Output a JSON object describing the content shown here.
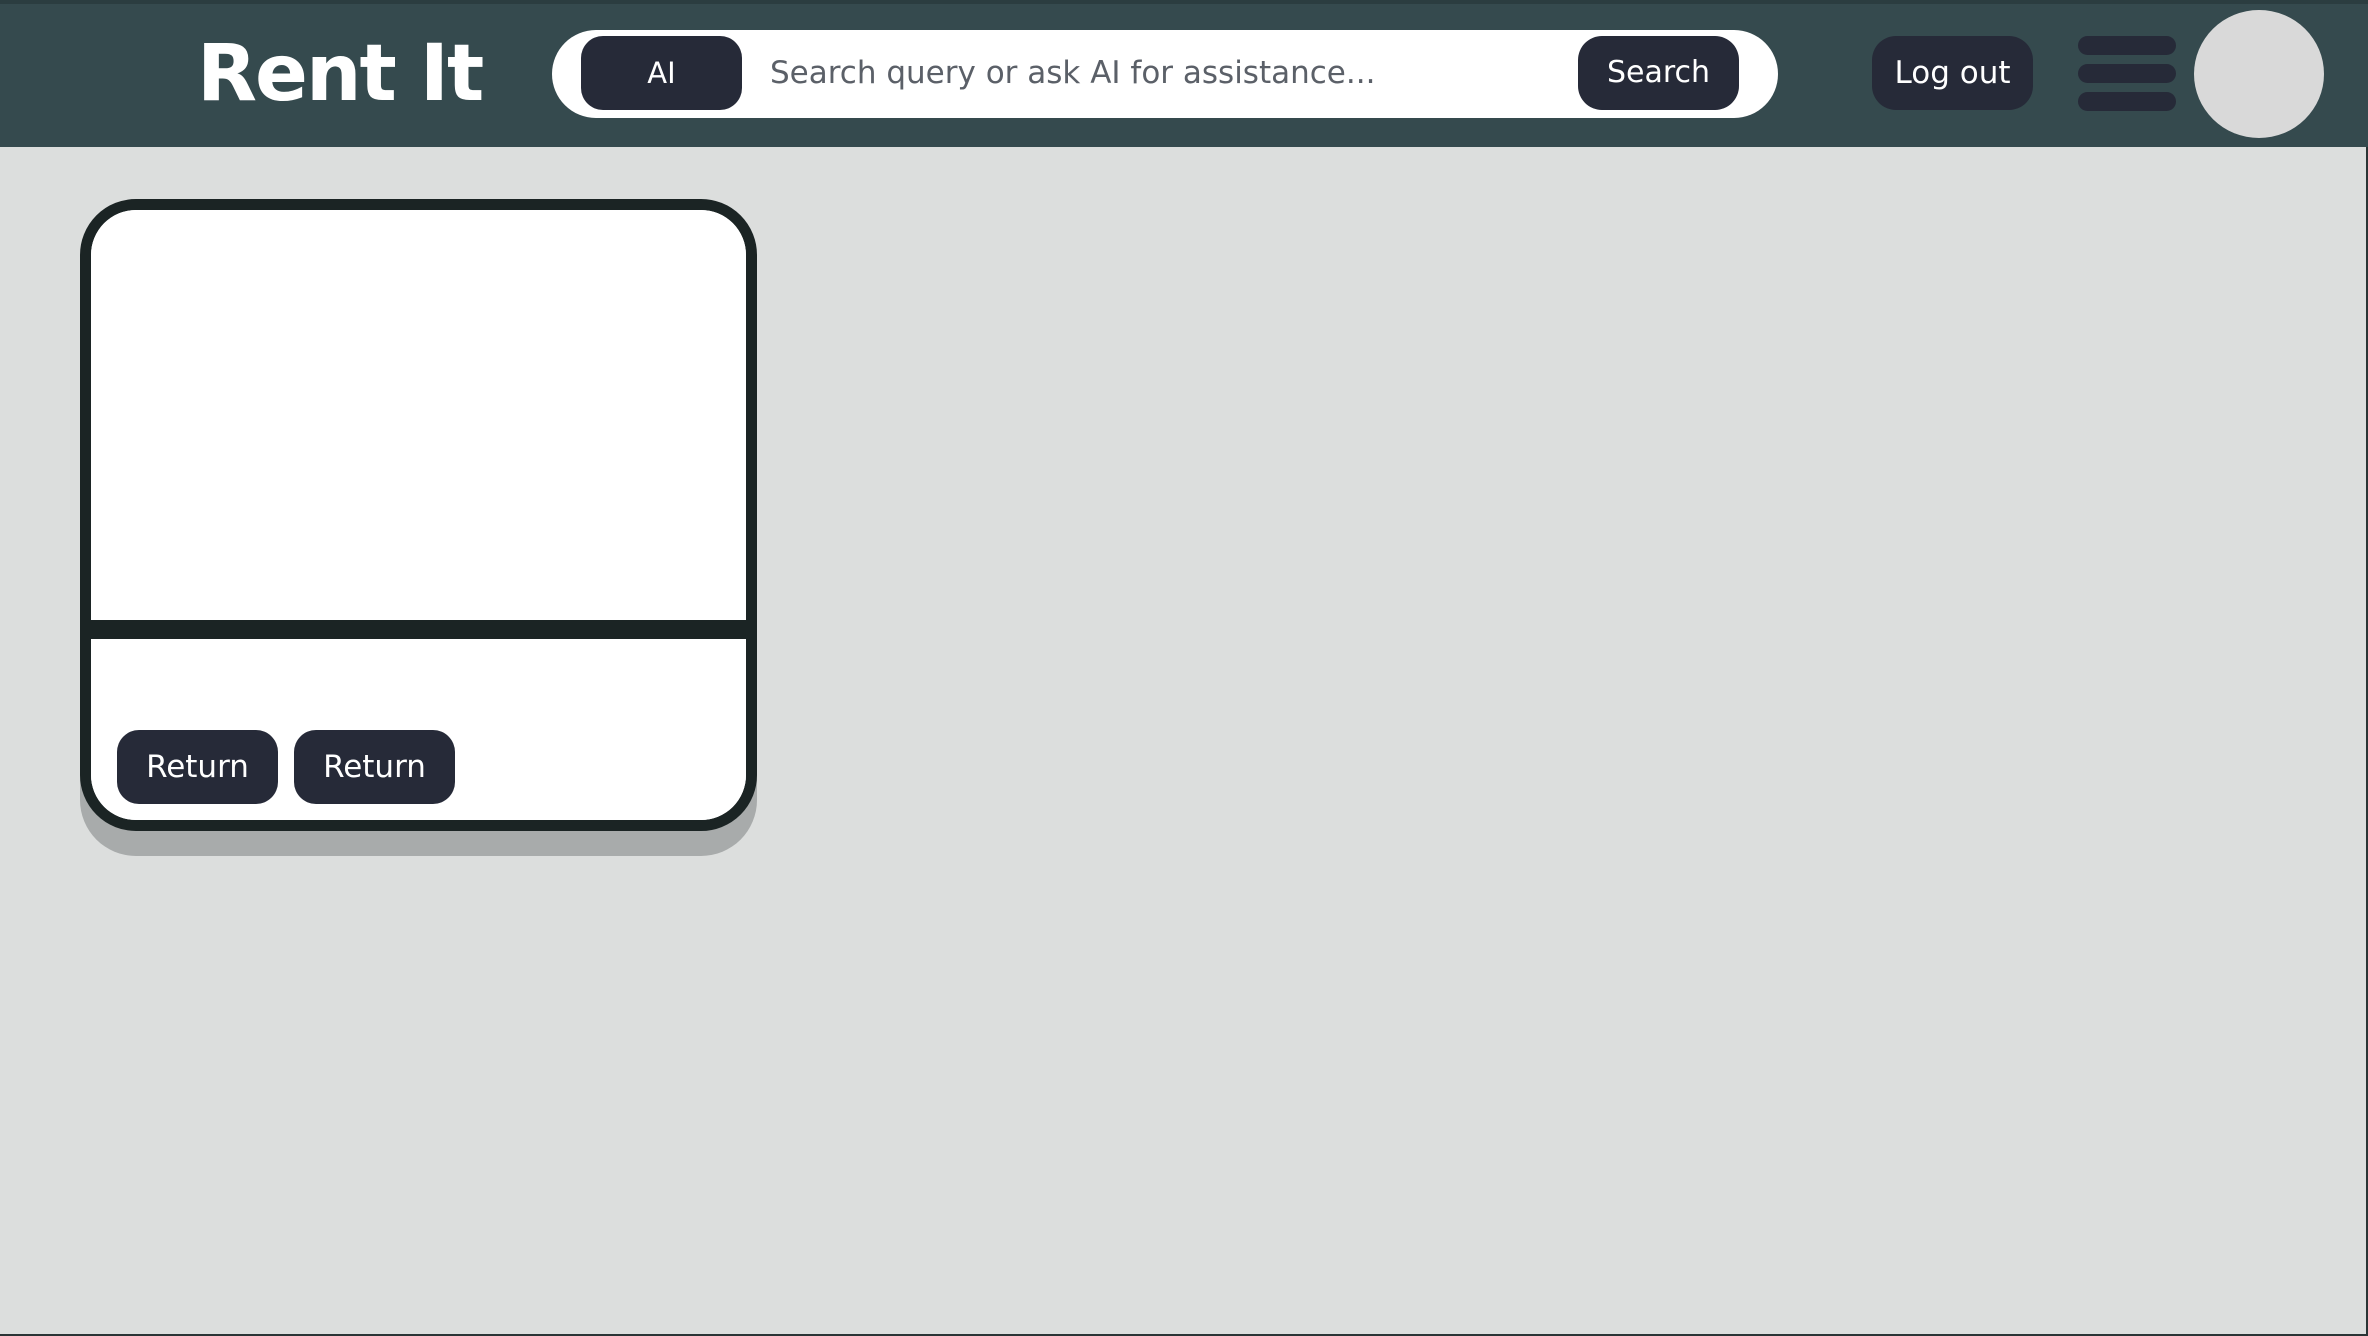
{
  "header": {
    "brand": "Rent It",
    "search": {
      "ai_label": "AI",
      "placeholder": "Search query or ask AI for assistance...",
      "value": "",
      "search_label": "Search"
    },
    "logout_label": "Log out",
    "menu_icon": "hamburger-menu-icon",
    "avatar_icon": "user-avatar"
  },
  "colors": {
    "header_bg": "#354a4e",
    "page_bg": "#dcdedd",
    "button_bg": "#262a38",
    "card_border": "#1b2424"
  },
  "rentals": [
    {
      "image_alt": "",
      "buttons": [
        {
          "label": "Return"
        },
        {
          "label": "Return"
        }
      ]
    }
  ]
}
